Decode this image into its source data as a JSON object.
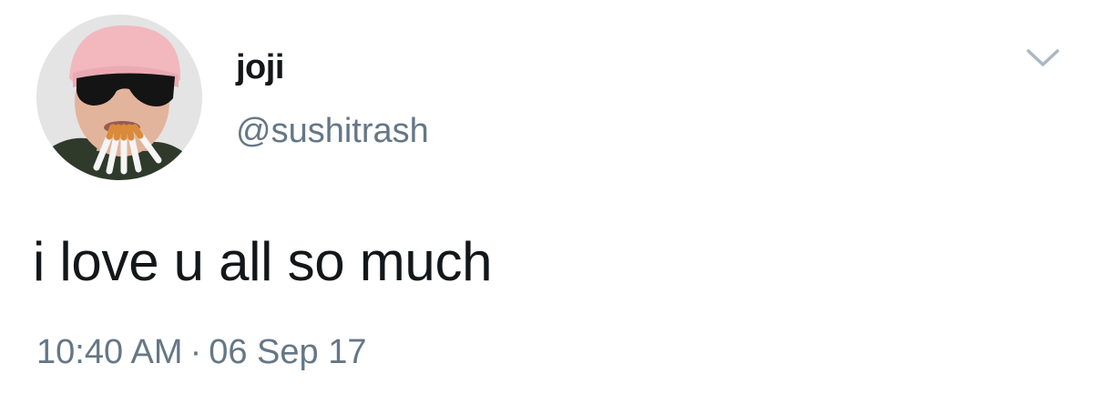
{
  "tweet": {
    "author": {
      "display_name": "joji",
      "handle": "@sushitrash",
      "avatar_icon": "profile-avatar"
    },
    "menu_icon": "chevron-down-icon",
    "text": "i love u all so much",
    "time": "10:40 AM",
    "separator": "·",
    "date": "06 Sep 17"
  },
  "colors": {
    "primary_text": "#14171a",
    "secondary_text": "#657786",
    "background": "#ffffff",
    "chevron": "#aab8c2"
  }
}
